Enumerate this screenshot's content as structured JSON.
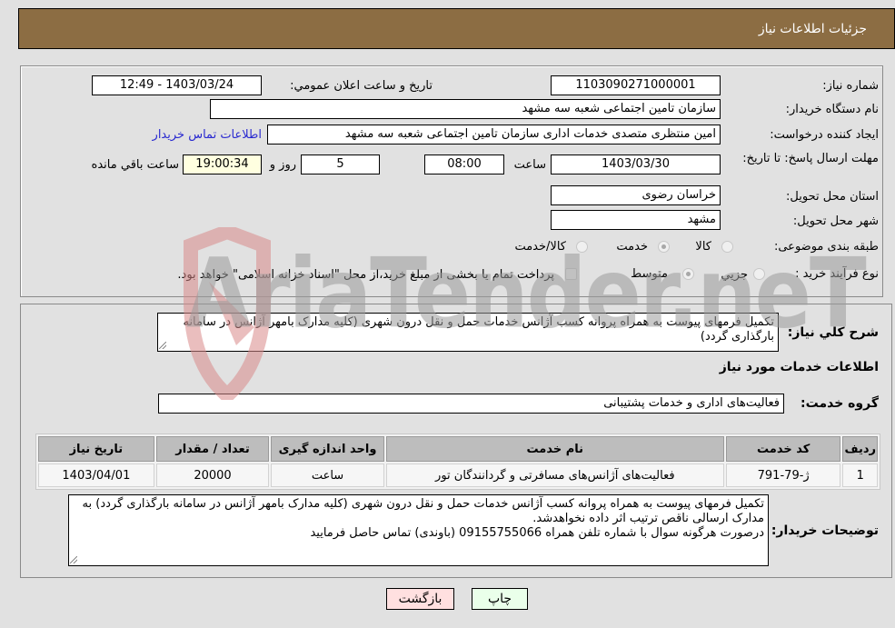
{
  "header": {
    "title": "جزئیات اطلاعات نیاز"
  },
  "form": {
    "need_number": {
      "label": "شماره نیاز:",
      "value": "1103090271000001"
    },
    "announce_datetime": {
      "label": "تاريخ و ساعت اعلان عمومي:",
      "value": "1403/03/24 - 12:49"
    },
    "buyer_org": {
      "label": "نام دستگاه خريدار:",
      "value": "سازمان تامین اجتماعی شعبه سه مشهد"
    },
    "requester": {
      "label": "ايجاد کننده درخواست:",
      "value": "امین منتظری متصدی خدمات اداری سازمان تامین اجتماعی شعبه سه مشهد",
      "contact_link": "اطلاعات تماس خریدار"
    },
    "deadline": {
      "label": "مهلت ارسال پاسخ: تا تاریخ:",
      "date": "1403/03/30",
      "time_label": "ساعت",
      "time": "08:00",
      "days": "5",
      "days_label": "روز و",
      "remaining": "19:00:34",
      "remaining_label": "ساعت باقي مانده"
    },
    "province": {
      "label": "استان محل تحویل:",
      "value": "خراسان رضوی"
    },
    "city": {
      "label": "شهر محل تحویل:",
      "value": "مشهد"
    },
    "category": {
      "label": "طبقه بندی موضوعی:",
      "options": [
        "کالا",
        "خدمت",
        "کالا/خدمت"
      ],
      "selected": "خدمت"
    },
    "purchase_type": {
      "label": "نوع فرآيند خريد :",
      "options": [
        "جزيي",
        "متوسط"
      ],
      "selected": "متوسط",
      "treasury_checkbox_label": "پرداخت تمام يا بخشی از مبلغ خريد،از محل \"اسناد خزانه اسلامی\" خواهد بود.",
      "treasury_checked": false
    }
  },
  "description": {
    "label": "شرح کلي نياز:",
    "value": "تکمیل فرمهای پیوست به همراه پروانه کسب آژانس خدمات حمل و نقل درون شهری (کلیه مدارک بامهر آژانس در سامانه بارگذاری گردد)"
  },
  "services_section": {
    "title": "اطلاعات خدمات مورد نياز"
  },
  "service_group": {
    "label": "گروه خدمت:",
    "value": "فعالیت‌های اداری و خدمات پشتیبانی"
  },
  "table": {
    "headers": [
      "رديف",
      "کد خدمت",
      "نام خدمت",
      "واحد اندازه گیری",
      "تعداد / مقدار",
      "تاريخ نياز"
    ],
    "rows": [
      [
        "1",
        "ژ-79-791",
        "فعالیت‌های آژانس‌های مسافرتی و گردانندگان تور",
        "ساعت",
        "20000",
        "1403/04/01"
      ]
    ]
  },
  "buyer_notes": {
    "label": "توضيحات خريدار:",
    "value": "تکمیل فرمهای پیوست به همراه پروانه کسب آژانس خدمات حمل و نقل درون شهری (کلیه مدارک بامهر آژانس در سامانه بارگذاری گردد) به مدارک ارسالی ناقص ترتیب اثر داده نخواهدشد.\nدرصورت هرگونه سوال با شماره تلفن همراه 09155755066 (باوندی) تماس حاصل فرمایید"
  },
  "buttons": {
    "print": "چاپ",
    "back": "بازگشت"
  },
  "watermark": {
    "text": "AriaTender.neT"
  },
  "colors": {
    "header_bg": "#8c6d43",
    "page_bg": "#e1e1e1",
    "link": "#2a2ad0",
    "print_bg": "#eaffea",
    "back_bg": "#ffe0e0",
    "remaining_bg": "#ffffe0"
  }
}
